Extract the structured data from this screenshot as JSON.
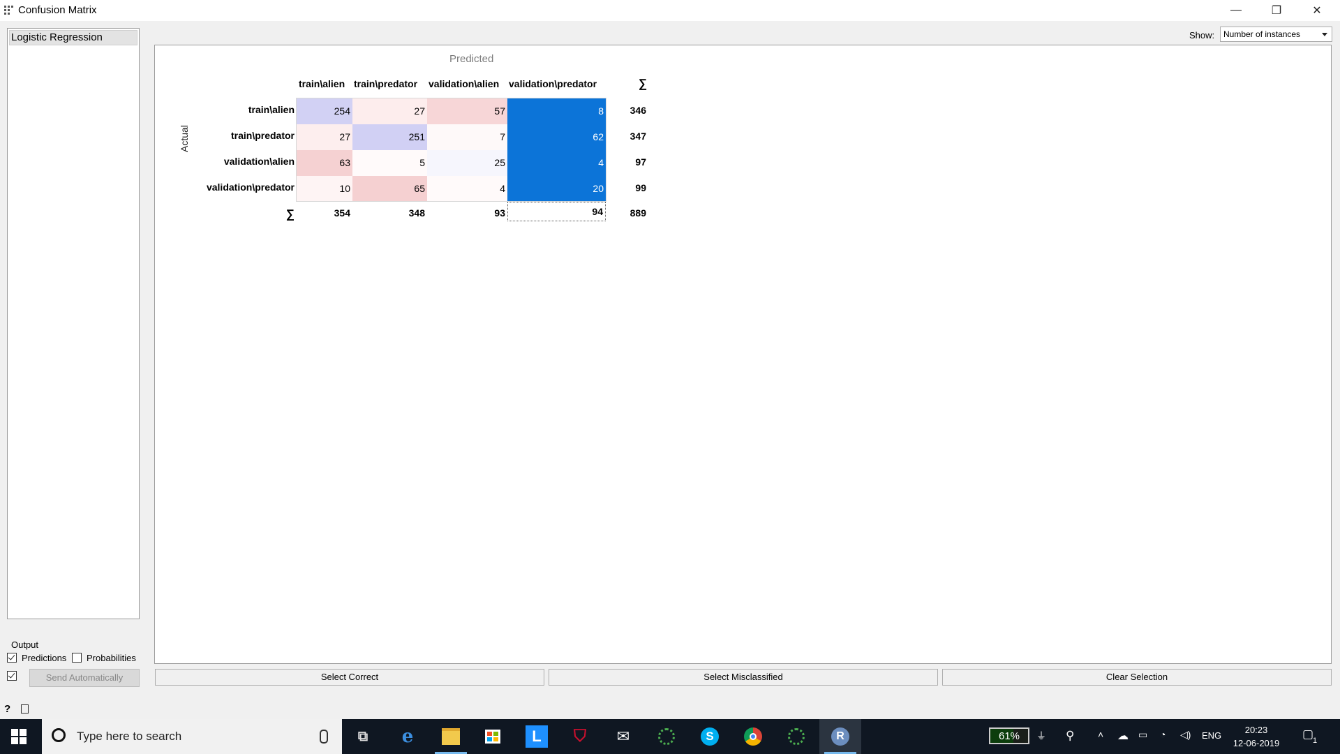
{
  "window": {
    "title": "Confusion Matrix",
    "minimize": "—",
    "restore": "❐",
    "close": "✕"
  },
  "models": [
    "Logistic Regression"
  ],
  "output": {
    "title": "Output",
    "predictions_label": "Predictions",
    "predictions_checked": true,
    "probabilities_label": "Probabilities",
    "probabilities_checked": false,
    "auto_send_checked": true,
    "send_button": "Send Automatically"
  },
  "show": {
    "label": "Show:",
    "value": "Number of instances"
  },
  "matrix": {
    "predicted_label": "Predicted",
    "actual_label": "Actual",
    "sigma": "∑",
    "columns": [
      "train\\alien",
      "train\\predator",
      "validation\\alien",
      "validation\\predator"
    ],
    "rows": [
      {
        "label": "train\\alien",
        "values": [
          "254",
          "27",
          "57",
          "8"
        ],
        "total": "346"
      },
      {
        "label": "train\\predator",
        "values": [
          "27",
          "251",
          "7",
          "62"
        ],
        "total": "347"
      },
      {
        "label": "validation\\alien",
        "values": [
          "63",
          "5",
          "25",
          "4"
        ],
        "total": "97"
      },
      {
        "label": "validation\\predator",
        "values": [
          "10",
          "65",
          "4",
          "20"
        ],
        "total": "99"
      }
    ],
    "col_totals": [
      "354",
      "348",
      "93",
      "94"
    ],
    "grand_total": "889",
    "cell_colors": [
      [
        "#d2d1f4",
        "#fdeded",
        "#f7d6d7",
        "#0c74d8"
      ],
      [
        "#fdeeee",
        "#d1d0f4",
        "#fef9f9",
        "#0c74d8"
      ],
      [
        "#f5d1d2",
        "#fffafa",
        "#f6f6fd",
        "#0c74d8"
      ],
      [
        "#fef4f4",
        "#f5d0d1",
        "#fffafa",
        "#0c74d8"
      ]
    ],
    "selected_text_color": "#ffffff"
  },
  "buttons": {
    "select_correct": "Select Correct",
    "select_misclassified": "Select Misclassified",
    "clear_selection": "Clear Selection"
  },
  "status": {
    "help": "?"
  },
  "taskbar": {
    "search_placeholder": "Type here to search",
    "battery": "61%",
    "language": "ENG",
    "time": "20:23",
    "date": "12-06-2019",
    "notifications": "1"
  }
}
